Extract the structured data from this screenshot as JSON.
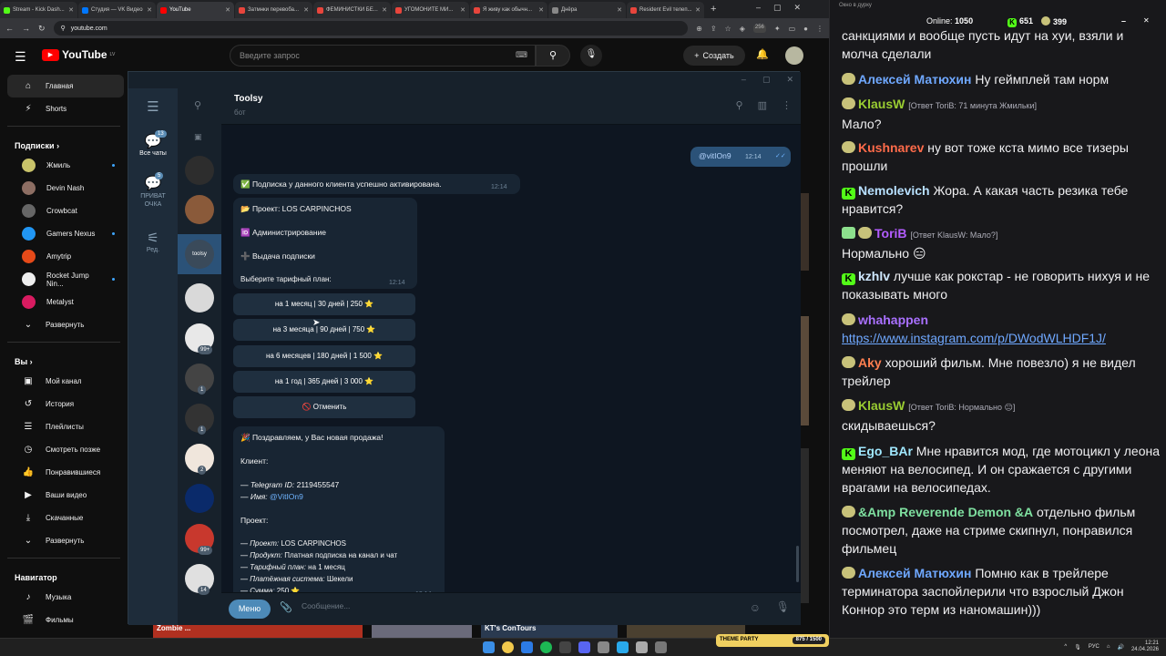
{
  "browser": {
    "tabs": [
      {
        "label": "Stream - Kick Dash...",
        "color": "#53fc18"
      },
      {
        "label": "Студия — VK Видео",
        "color": "#0077ff"
      },
      {
        "label": "YouTube",
        "color": "#ff0000",
        "active": true
      },
      {
        "label": "Затмнки перевоба...",
        "color": "#e8453c"
      },
      {
        "label": "ФЕМИНИСТКИ БЕ...",
        "color": "#e8453c"
      },
      {
        "label": "УГОМОНИТЕ МИ...",
        "color": "#e8453c"
      },
      {
        "label": "Я живу как обычн...",
        "color": "#e8453c"
      },
      {
        "label": "Днёра",
        "color": "#888888"
      },
      {
        "label": "Resident Evil телеп...",
        "color": "#e8453c"
      }
    ],
    "new_tab": "+",
    "url": "youtube.com",
    "ext_badge": "256"
  },
  "youtube": {
    "logo": "YouTube",
    "logo_suffix": "LV",
    "search_placeholder": "Введите запрос",
    "create_label": "Создать",
    "nav": [
      {
        "label": "Главная",
        "icon": "⌂",
        "active": true
      },
      {
        "label": "Shorts",
        "icon": "⚡"
      }
    ],
    "subs_header": "Подписки  ›",
    "subs": [
      {
        "label": "Жмиль",
        "dot": true,
        "color": "#c9c36a"
      },
      {
        "label": "Devin Nash",
        "dot": false,
        "color": "#8d6e63"
      },
      {
        "label": "Crowbcat",
        "dot": false,
        "color": "#666666"
      },
      {
        "label": "Gamers Nexus",
        "dot": true,
        "color": "#2196f3"
      },
      {
        "label": "Amytrip",
        "dot": false,
        "color": "#e64a19"
      },
      {
        "label": "Rocket Jump Nin...",
        "dot": true,
        "color": "#eeeeee"
      },
      {
        "label": "Metalyst",
        "dot": false,
        "color": "#d81b60"
      }
    ],
    "expand_label": "Развернуть",
    "you_header": "Вы  ›",
    "you": [
      {
        "label": "Мой канал",
        "icon": "▣"
      },
      {
        "label": "История",
        "icon": "↺"
      },
      {
        "label": "Плейлисты",
        "icon": "☰"
      },
      {
        "label": "Смотреть позже",
        "icon": "◷"
      },
      {
        "label": "Понравившиеся",
        "icon": "👍"
      },
      {
        "label": "Ваши видео",
        "icon": "▶"
      },
      {
        "label": "Скачанные",
        "icon": "⤓"
      }
    ],
    "expand_label2": "Развернуть",
    "nav_header": "Навигатор",
    "navigator": [
      {
        "label": "Музыка",
        "icon": "♪"
      },
      {
        "label": "Фильмы",
        "icon": "🎬"
      }
    ],
    "bottom_thumbs": [
      "Zombie ...",
      "",
      "KT's ConTours",
      ""
    ]
  },
  "telegram": {
    "rail": [
      {
        "label": "Все чаты",
        "badge": "13",
        "icon": "💬"
      },
      {
        "label": "ПРИВАТ ОЧКА",
        "badge": "5",
        "icon": "💬"
      },
      {
        "label": "Ред.",
        "icon": "⚙"
      }
    ],
    "chat_list_badges": [
      "99+",
      "1",
      "1",
      "2",
      "99+",
      "14"
    ],
    "selected_chat_short": "toolsy",
    "chat_name": "Toolsy",
    "chat_status": "бот",
    "out_msg": {
      "text": "@vitIOn9",
      "time": "12:14"
    },
    "activated": {
      "text": "✅ Подписка у данного клиента успешно активирована.",
      "time": "12:14"
    },
    "card": {
      "project": "📂 Проект: LOS CARPINCHOS",
      "admin": "🆔 Администрирование",
      "issue": "➕ Выдача подписки",
      "choose": "Выберите тарифный план:",
      "time": "12:14"
    },
    "buttons": [
      "на 1 месяц | 30 дней | 250 ⭐",
      "на 3 месяца | 90 дней | 750 ⭐",
      "на 6 месяцев | 180 дней | 1 500 ⭐",
      "на 1 год | 365 дней | 3 000 ⭐",
      "🚫 Отменить"
    ],
    "sale": {
      "title": "🎉 Поздравляем, у Вас новая продажа!",
      "client_h": "Клиент:",
      "tg_id_label": "— Telegram ID:",
      "tg_id": "2119455547",
      "name_label": "— Имя:",
      "name": "@VitIOn9",
      "proj_h": "Проект:",
      "proj_label": "— Проект:",
      "proj": "LOS CARPINCHOS",
      "prod_label": "— Продукт:",
      "prod": "Платная подписка на канал и чат",
      "plan_label": "— Тарифный план:",
      "plan": "на 1 месяц",
      "pay_label": "— Платёжная система:",
      "pay": "Шекели",
      "sum_label": "— Сумма:",
      "sum": "250 ⭐",
      "time": "12:14"
    },
    "menu_label": "Меню",
    "input_placeholder": "Сообщение..."
  },
  "stream_chat": {
    "title": "Окно в дурку",
    "online_label": "Online:",
    "online": "1050",
    "kick_count": "651",
    "coin_count": "399",
    "messages": [
      {
        "user": "",
        "color": "#efeff1",
        "text": "санкциями и вообще пусть идут на хуи, взяли и молча сделали",
        "badge": ""
      },
      {
        "user": "Алексей Матюхин",
        "color": "#6fa8ff",
        "text": "Ну геймплей там норм",
        "badge": "y"
      },
      {
        "user": "KlausW",
        "color": "#9acd32",
        "reply": "[Ответ ToriB: 71 минута Жмильки]",
        "text": "Мало?",
        "badge": "y"
      },
      {
        "user": "Kushnarev",
        "color": "#ff6b4a",
        "text": "ну вот тоже кста мимо все тизеры прошли",
        "badge": "y"
      },
      {
        "user": "Nemolevich",
        "color": "#b8e0ff",
        "text": "Жора. А какая часть резика тебе нравится?",
        "badge": "k"
      },
      {
        "user": "ToriB",
        "color": "#b35cff",
        "reply": "[Ответ KlausW: Мало?]",
        "text": "Нормально 😑",
        "badge": "sy"
      },
      {
        "user": "kzhlv",
        "color": "#cfe8ff",
        "text": "лучше как рокстар - не говорить нихуя и не показывать много",
        "badge": "k"
      },
      {
        "user": "whahappen",
        "color": "#a970ff",
        "text": "",
        "link": "https://www.instagram.com/p/DWodWLHDF1J/",
        "badge": "y"
      },
      {
        "user": "Aky",
        "color": "#ff7f50",
        "text": "хороший фильм. Мне повезло) я не видел трейлер",
        "badge": "y"
      },
      {
        "user": "KlausW",
        "color": "#9acd32",
        "reply": "[Ответ ToriB: Нормально 😑]",
        "text": "скидываешься?",
        "badge": "y"
      },
      {
        "user": "Ego_BAr",
        "color": "#a0e8ff",
        "text": "Мне нравится мод, где мотоцикл у леона меняют на велосипед. И он сражается с другими врагами на велосипедах.",
        "badge": "k"
      },
      {
        "user": "&Amp Reverende Demon &A",
        "color": "#7fe0a0",
        "text": "отдельно фильм посмотрел, даже на стриме скипнул, понравился фильмец",
        "badge": "y"
      },
      {
        "user": "Алексей Матюхин",
        "color": "#6fa8ff",
        "text": "Помню как в трейлере терминатора заспойлерили что взрослый Джон Коннор это терм из наномашин)))",
        "badge": "y"
      }
    ]
  },
  "taskbar": {
    "lang": "РУС",
    "time": "12:21",
    "date": "24.04.2026",
    "game_label": "THEME PARTY",
    "game_score": "875 / 1500"
  }
}
